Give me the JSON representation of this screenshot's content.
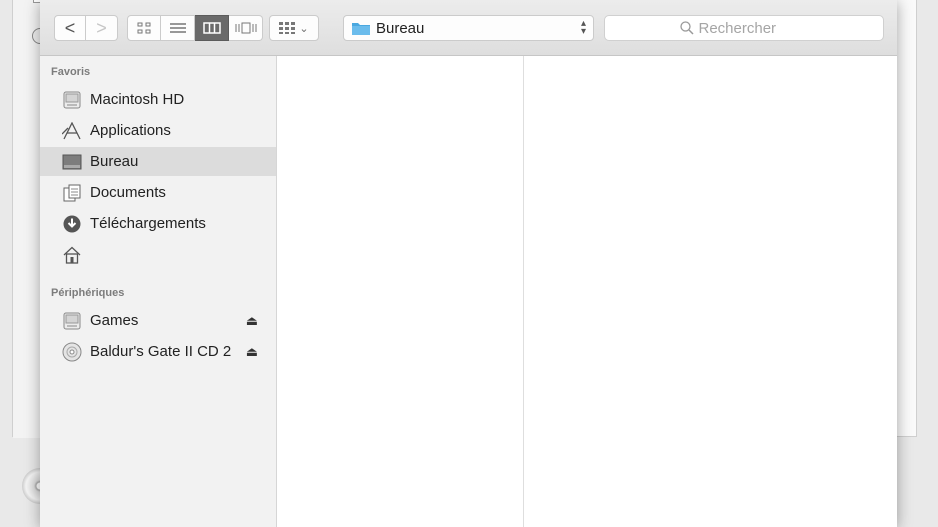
{
  "toolbar": {
    "back": "<",
    "forward": ">",
    "views": [
      "icon-view",
      "list-view",
      "column-view",
      "coverflow-view"
    ],
    "active_view": "column-view",
    "location": "Bureau",
    "search_placeholder": "Rechercher"
  },
  "sidebar": {
    "favorites_title": "Favoris",
    "favorites": [
      {
        "label": "Macintosh HD",
        "icon": "hard-drive-icon"
      },
      {
        "label": "Applications",
        "icon": "applications-icon"
      },
      {
        "label": "Bureau",
        "icon": "desktop-icon",
        "selected": true
      },
      {
        "label": "Documents",
        "icon": "documents-icon"
      },
      {
        "label": "Téléchargements",
        "icon": "downloads-icon"
      },
      {
        "label": "",
        "icon": "home-icon"
      }
    ],
    "devices_title": "Périphériques",
    "devices": [
      {
        "label": "Games",
        "icon": "disk-image-icon",
        "eject": "⏏"
      },
      {
        "label": "Baldur's Gate II CD 2",
        "icon": "cd-icon",
        "eject": "⏏"
      }
    ]
  },
  "colors": {
    "selection": "#dcdcdc",
    "folder_blue": "#4aa8e0",
    "active_view_btn": "#6a6a6a"
  }
}
